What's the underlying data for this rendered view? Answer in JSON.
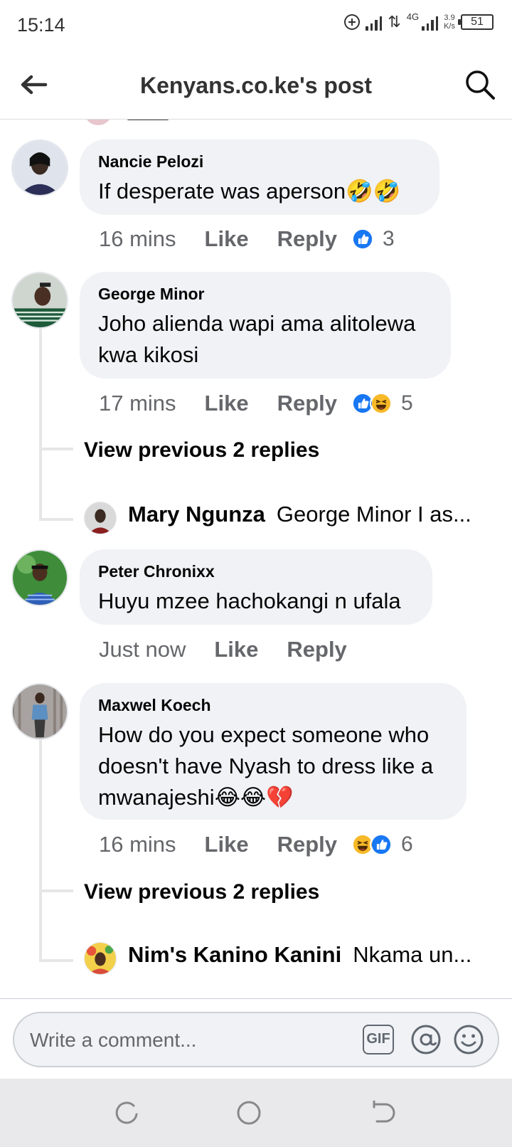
{
  "status_bar": {
    "time": "15:14",
    "network": "4G",
    "speed_value": "3.9",
    "speed_unit": "K/s",
    "battery": "51"
  },
  "header": {
    "title": "Kenyans.co.ke's post",
    "back_icon": "arrow-left-icon",
    "search_icon": "search-icon"
  },
  "comments": [
    {
      "name": "Nancie Pelozi",
      "text": "If desperate was aperson🤣🤣",
      "time": "16 mins",
      "like": "Like",
      "reply": "Reply",
      "reactions": [
        "like"
      ],
      "reaction_count": "3"
    },
    {
      "name": "George Minor",
      "text": "Joho alienda wapi ama alitolewa kwa kikosi",
      "time": "17 mins",
      "like": "Like",
      "reply": "Reply",
      "reactions": [
        "like",
        "haha"
      ],
      "reaction_count": "5",
      "view_previous": "View previous 2 replies",
      "latest_reply": {
        "name": "Mary Ngunza",
        "text": "George Minor I as..."
      }
    },
    {
      "name": "Peter Chronixx",
      "text": "Huyu mzee hachokangi n ufala",
      "time": "Just now",
      "like": "Like",
      "reply": "Reply"
    },
    {
      "name": "Maxwel Koech",
      "text": "How do you expect someone who doesn't have Nyash to dress like a mwanajeshi😂😂💔",
      "time": "16 mins",
      "like": "Like",
      "reply": "Reply",
      "reactions": [
        "haha",
        "like"
      ],
      "reaction_count": "6",
      "view_previous": "View previous 2 replies",
      "latest_reply": {
        "name": "Nim's Kanino Kanini",
        "text": "Nkama un..."
      }
    }
  ],
  "composer": {
    "placeholder": "Write a comment...",
    "gif_label": "GIF",
    "at_icon": "mention-icon",
    "emoji_icon": "emoji-icon"
  },
  "colors": {
    "bubble": "#f0f2f5",
    "like_blue": "#1877f2",
    "haha_yellow": "#f7b928",
    "meta_gray": "#65676b"
  }
}
